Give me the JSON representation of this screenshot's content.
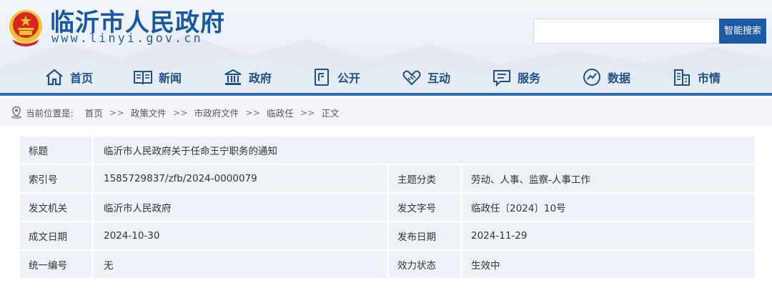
{
  "header": {
    "site_title": "临沂市人民政府",
    "site_url": "www.linyi.gov.cn",
    "search": {
      "placeholder": "",
      "button_label": "智能搜索"
    }
  },
  "nav": {
    "items": [
      {
        "label": "首页",
        "icon": "home-icon"
      },
      {
        "label": "新闻",
        "icon": "newspaper-icon"
      },
      {
        "label": "政府",
        "icon": "government-building-icon"
      },
      {
        "label": "公开",
        "icon": "disclosure-icon"
      },
      {
        "label": "互动",
        "icon": "handshake-icon"
      },
      {
        "label": "服务",
        "icon": "chat-service-icon"
      },
      {
        "label": "数据",
        "icon": "data-globe-icon"
      },
      {
        "label": "市情",
        "icon": "city-building-icon"
      }
    ]
  },
  "breadcrumb": {
    "label": "当前位置是:",
    "separator": ">>",
    "items": [
      "首页",
      "政策文件",
      "市政府文件",
      "临政任",
      "正文"
    ]
  },
  "info": {
    "title_label": "标题",
    "title_value": "临沂市人民政府关于任命王宁职务的通知",
    "rows": [
      {
        "label1": "索引号",
        "value1": "1585729837/zfb/2024-0000079",
        "label2": "主题分类",
        "value2": "劳动、人事、监察-人事工作"
      },
      {
        "label1": "发文机关",
        "value1": "临沂市人民政府",
        "label2": "发文字号",
        "value2": "临政任〔2024〕10号"
      },
      {
        "label1": "成文日期",
        "value1": "2024-10-30",
        "label2": "发布日期",
        "value2": "2024-11-29"
      },
      {
        "label1": "统一编号",
        "value1": "无",
        "label2": "效力状态",
        "value2": "生效中"
      }
    ]
  },
  "colors": {
    "brand_blue": "#1557a8",
    "nav_text": "#1d4f8e",
    "accent_bar": "#2e6bb5",
    "emblem_red": "#d7261e",
    "emblem_gold": "#f2c230",
    "table_cell": "#edf2f8"
  }
}
